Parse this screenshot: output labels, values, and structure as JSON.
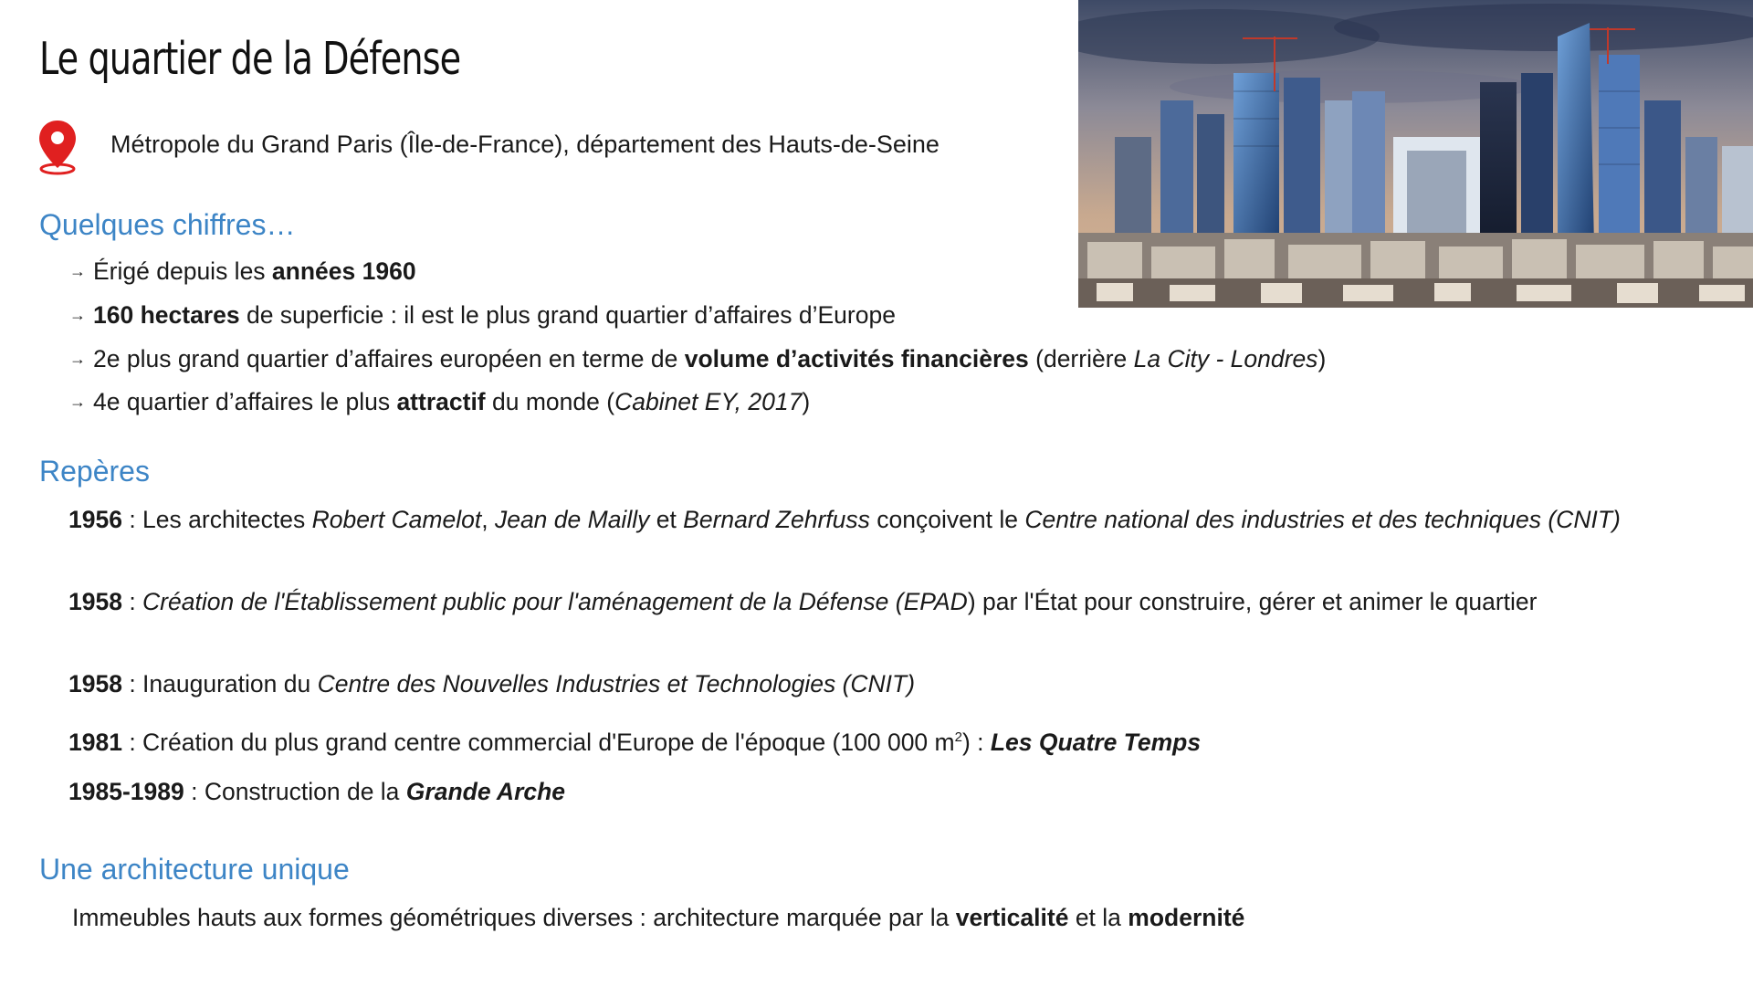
{
  "title": "Le quartier de la Défense",
  "location": "Métropole du Grand Paris (Île-de-France), département des Hauts-de-Seine",
  "icons": {
    "location": "map-pin-icon",
    "bullet": "small-arrow-icon"
  },
  "colors": {
    "heading": "#3d85c6",
    "pin": "#e02020",
    "text": "#1a1a1a"
  },
  "sections": {
    "chiffres": "Quelques chiffres…",
    "reperes": "Repères",
    "architecture": "Une architecture unique"
  },
  "bullet_glyph": "→",
  "chiffres": [
    {
      "a": "Érigé depuis les ",
      "b": "années 1960"
    },
    {
      "b": "160 hectares",
      "a": " de superficie : il est le plus grand quartier d’affaires d’Europe"
    },
    {
      "a": "2e plus grand quartier d’affaires européen en terme de ",
      "b": "volume d’activités financières",
      "c": " (derrière ",
      "d": "La City -  Londres",
      "e": ")"
    },
    {
      "a": "4e quartier d’affaires le plus ",
      "b": "attractif",
      "c": " du monde (",
      "d": "Cabinet EY, 2017",
      "e": ")"
    }
  ],
  "reperes": [
    {
      "year": "1956",
      "t1": " : Les architectes ",
      "i1": "Robert Camelot",
      "t2": ", ",
      "i2": "Jean de Mailly",
      "t3": " et ",
      "i3": "Bernard Zehrfuss",
      "t4": " conçoivent le ",
      "i4": "Centre national des industries et des techniques (CNIT)"
    },
    {
      "year": "1958",
      "t1": " : ",
      "i1": "Création de l'Établissement public pour l'aménagement de la Défense (EPAD",
      "t2": ") par l'État pour construire, gérer et animer le quartier"
    },
    {
      "year": "1958",
      "t1": " : Inauguration du ",
      "i1": "Centre des Nouvelles Industries et Technologies (CNIT)"
    },
    {
      "year": "1981",
      "t1": " : Création du plus grand centre commercial d'Europe de l'époque (100 000 m",
      "sup": "2",
      "t2": ") : ",
      "bi": "Les Quatre Temps"
    },
    {
      "year": "1985-1989",
      "t1": " : Construction de la ",
      "bi": "Grande Arche"
    }
  ],
  "architecture": {
    "a": "Immeubles hauts aux formes géométriques diverses : architecture marquée par la ",
    "b1": "verticalité",
    "c": " et la ",
    "b2": "modernité"
  }
}
